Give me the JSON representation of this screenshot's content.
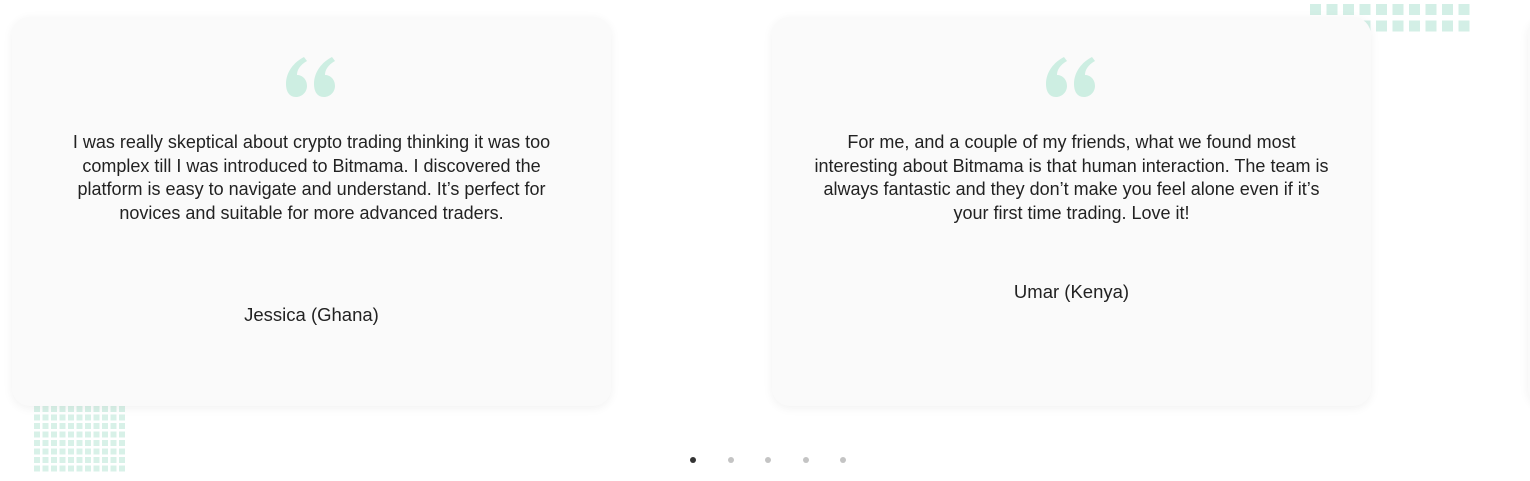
{
  "colors": {
    "accent_mint": "#cdeee2",
    "card_bg": "#fafafa",
    "text": "#222222",
    "dot_active": "#333333",
    "dot_inactive": "#c4c4c4"
  },
  "testimonials": [
    {
      "quote_icon": "quote-open-icon",
      "text": "I was really skeptical about crypto trading thinking it was too complex till I was introduced to Bitmama. I discovered the platform is easy to navigate and understand. It’s perfect for novices and suitable for more advanced traders.",
      "author": "Jessica (Ghana)"
    },
    {
      "quote_icon": "quote-open-icon",
      "text": "For me, and a couple of my friends, what we found most interesting about Bitmama is that human interaction. The team is always fantastic and they don’t make you feel alone even if it’s your first time trading. Love it!",
      "author": "Umar (Kenya)"
    }
  ],
  "pager": {
    "count": 5,
    "active_index": 0
  }
}
